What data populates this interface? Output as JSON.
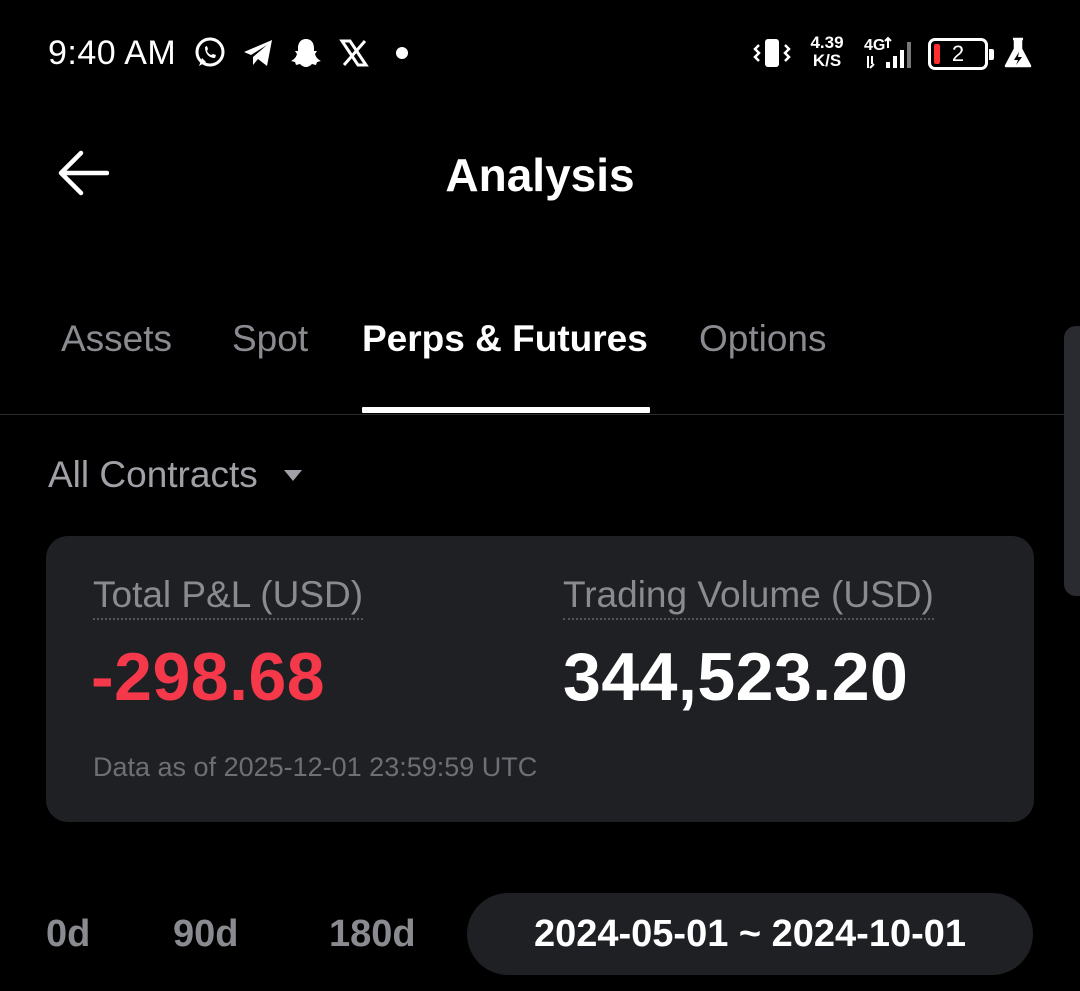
{
  "status_bar": {
    "time": "9:40 AM",
    "notification_icons": [
      "whatsapp-icon",
      "telegram-icon",
      "snapchat-icon",
      "x-icon",
      "dot-icon"
    ],
    "net_speed_value": "4.39",
    "net_speed_unit": "K/S",
    "network_type": "4G",
    "battery_level": "2",
    "battery_color": "#ff2d2d"
  },
  "header": {
    "title": "Analysis",
    "back_icon": "arrow-left-icon"
  },
  "tabs": [
    {
      "label": "Assets",
      "active": false
    },
    {
      "label": "Spot",
      "active": false
    },
    {
      "label": "Perps & Futures",
      "active": true
    },
    {
      "label": "Options",
      "active": false
    }
  ],
  "filter": {
    "selected": "All Contracts",
    "icon": "caret-down-icon"
  },
  "summary": {
    "pnl_label": "Total P&L (USD)",
    "pnl_value": "-298.68",
    "pnl_color": "#f5384a",
    "volume_label": "Trading Volume (USD)",
    "volume_value": "344,523.20",
    "data_as_of": "Data as of 2025-12-01 23:59:59 UTC"
  },
  "ranges": {
    "options": [
      "0d",
      "90d",
      "180d"
    ],
    "custom_range": "2024-05-01 ~ 2024-10-01"
  },
  "colors": {
    "background": "#000000",
    "card": "#1f2024",
    "muted_text": "#8a8b90",
    "negative": "#f5384a"
  }
}
